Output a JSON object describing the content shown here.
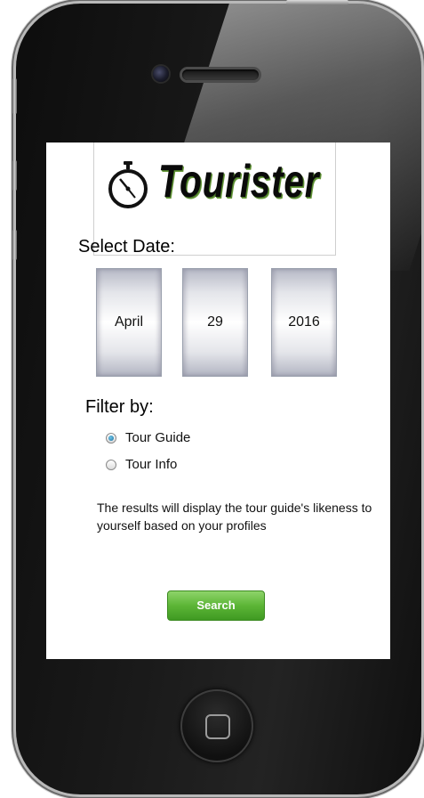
{
  "app": {
    "logo_text": "Tourister"
  },
  "date_section": {
    "label": "Select Date:",
    "month": "April",
    "day": "29",
    "year": "2016"
  },
  "filter_section": {
    "label": "Filter by:",
    "options": [
      {
        "label": "Tour Guide",
        "checked": true
      },
      {
        "label": "Tour Info",
        "checked": false
      }
    ]
  },
  "info_text": "The results will display the tour guide's likeness to yourself based on your profiles",
  "search_button": {
    "label": "Search"
  },
  "colors": {
    "button_green": "#5cb536",
    "radio_selected": "#1b6e9c"
  }
}
